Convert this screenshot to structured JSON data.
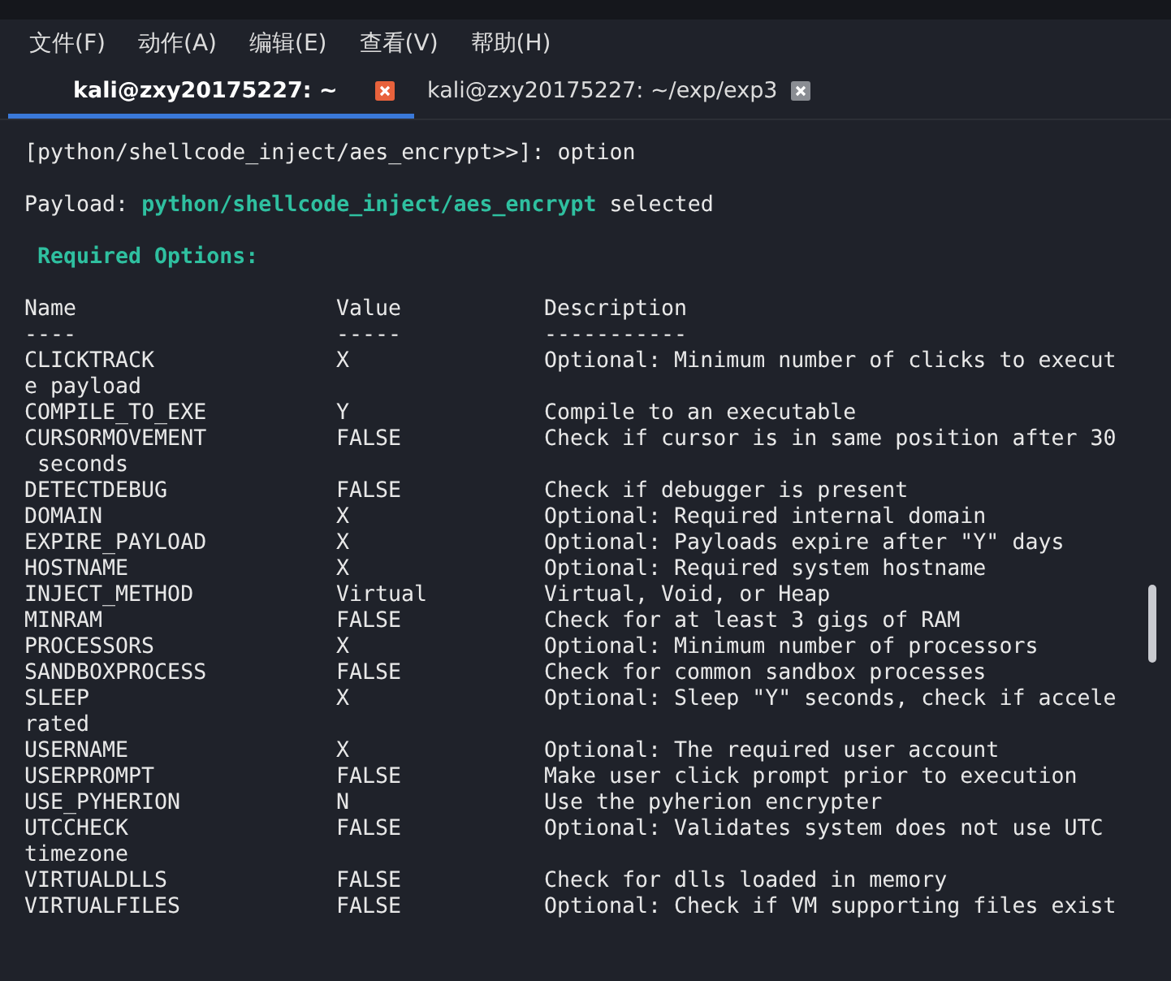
{
  "menu": [
    "文件(F)",
    "动作(A)",
    "编辑(E)",
    "查看(V)",
    "帮助(H)"
  ],
  "tabs": [
    {
      "label": "kali@zxy20175227: ~",
      "selected": true
    },
    {
      "label": "kali@zxy20175227: ~/exp/exp3",
      "selected": false
    }
  ],
  "terminal": {
    "prompt": "[python/shellcode_inject/aes_encrypt>>]: option",
    "payload_label": "Payload:",
    "payload_path": "python/shellcode_inject/aes_encrypt",
    "payload_suffix": "selected",
    "section_title": "Required Options:",
    "columns": [
      {
        "heading": "Name",
        "rule": "----"
      },
      {
        "heading": "Value",
        "rule": "-----"
      },
      {
        "heading": "Description",
        "rule": "-----------"
      }
    ],
    "rows": [
      {
        "name": "CLICKTRACK",
        "value": "X",
        "description": "Optional: Minimum number of clicks to execut",
        "wrap": "e payload"
      },
      {
        "name": "COMPILE_TO_EXE",
        "value": "Y",
        "description": "Compile to an executable"
      },
      {
        "name": "CURSORMOVEMENT",
        "value": "FALSE",
        "description": "Check if cursor is in same position after 30",
        "wrap": " seconds"
      },
      {
        "name": "DETECTDEBUG",
        "value": "FALSE",
        "description": "Check if debugger is present"
      },
      {
        "name": "DOMAIN",
        "value": "X",
        "description": "Optional: Required internal domain"
      },
      {
        "name": "EXPIRE_PAYLOAD",
        "value": "X",
        "description": "Optional: Payloads expire after \"Y\" days"
      },
      {
        "name": "HOSTNAME",
        "value": "X",
        "description": "Optional: Required system hostname"
      },
      {
        "name": "INJECT_METHOD",
        "value": "Virtual",
        "description": "Virtual, Void, or Heap"
      },
      {
        "name": "MINRAM",
        "value": "FALSE",
        "description": "Check for at least 3 gigs of RAM"
      },
      {
        "name": "PROCESSORS",
        "value": "X",
        "description": "Optional: Minimum number of processors"
      },
      {
        "name": "SANDBOXPROCESS",
        "value": "FALSE",
        "description": "Check for common sandbox processes"
      },
      {
        "name": "SLEEP",
        "value": "X",
        "description": "Optional: Sleep \"Y\" seconds, check if accele",
        "wrap": "rated"
      },
      {
        "name": "USERNAME",
        "value": "X",
        "description": "Optional: The required user account"
      },
      {
        "name": "USERPROMPT",
        "value": "FALSE",
        "description": "Make user click prompt prior to execution"
      },
      {
        "name": "USE_PYHERION",
        "value": "N",
        "description": "Use the pyherion encrypter"
      },
      {
        "name": "UTCCHECK",
        "value": "FALSE",
        "description": "Optional: Validates system does not use UTC",
        "wrap": "timezone"
      },
      {
        "name": "VIRTUALDLLS",
        "value": "FALSE",
        "description": "Check for dlls loaded in memory"
      },
      {
        "name": "VIRTUALFILES",
        "value": "FALSE",
        "description": "Optional: Check if VM supporting files exist"
      }
    ]
  }
}
